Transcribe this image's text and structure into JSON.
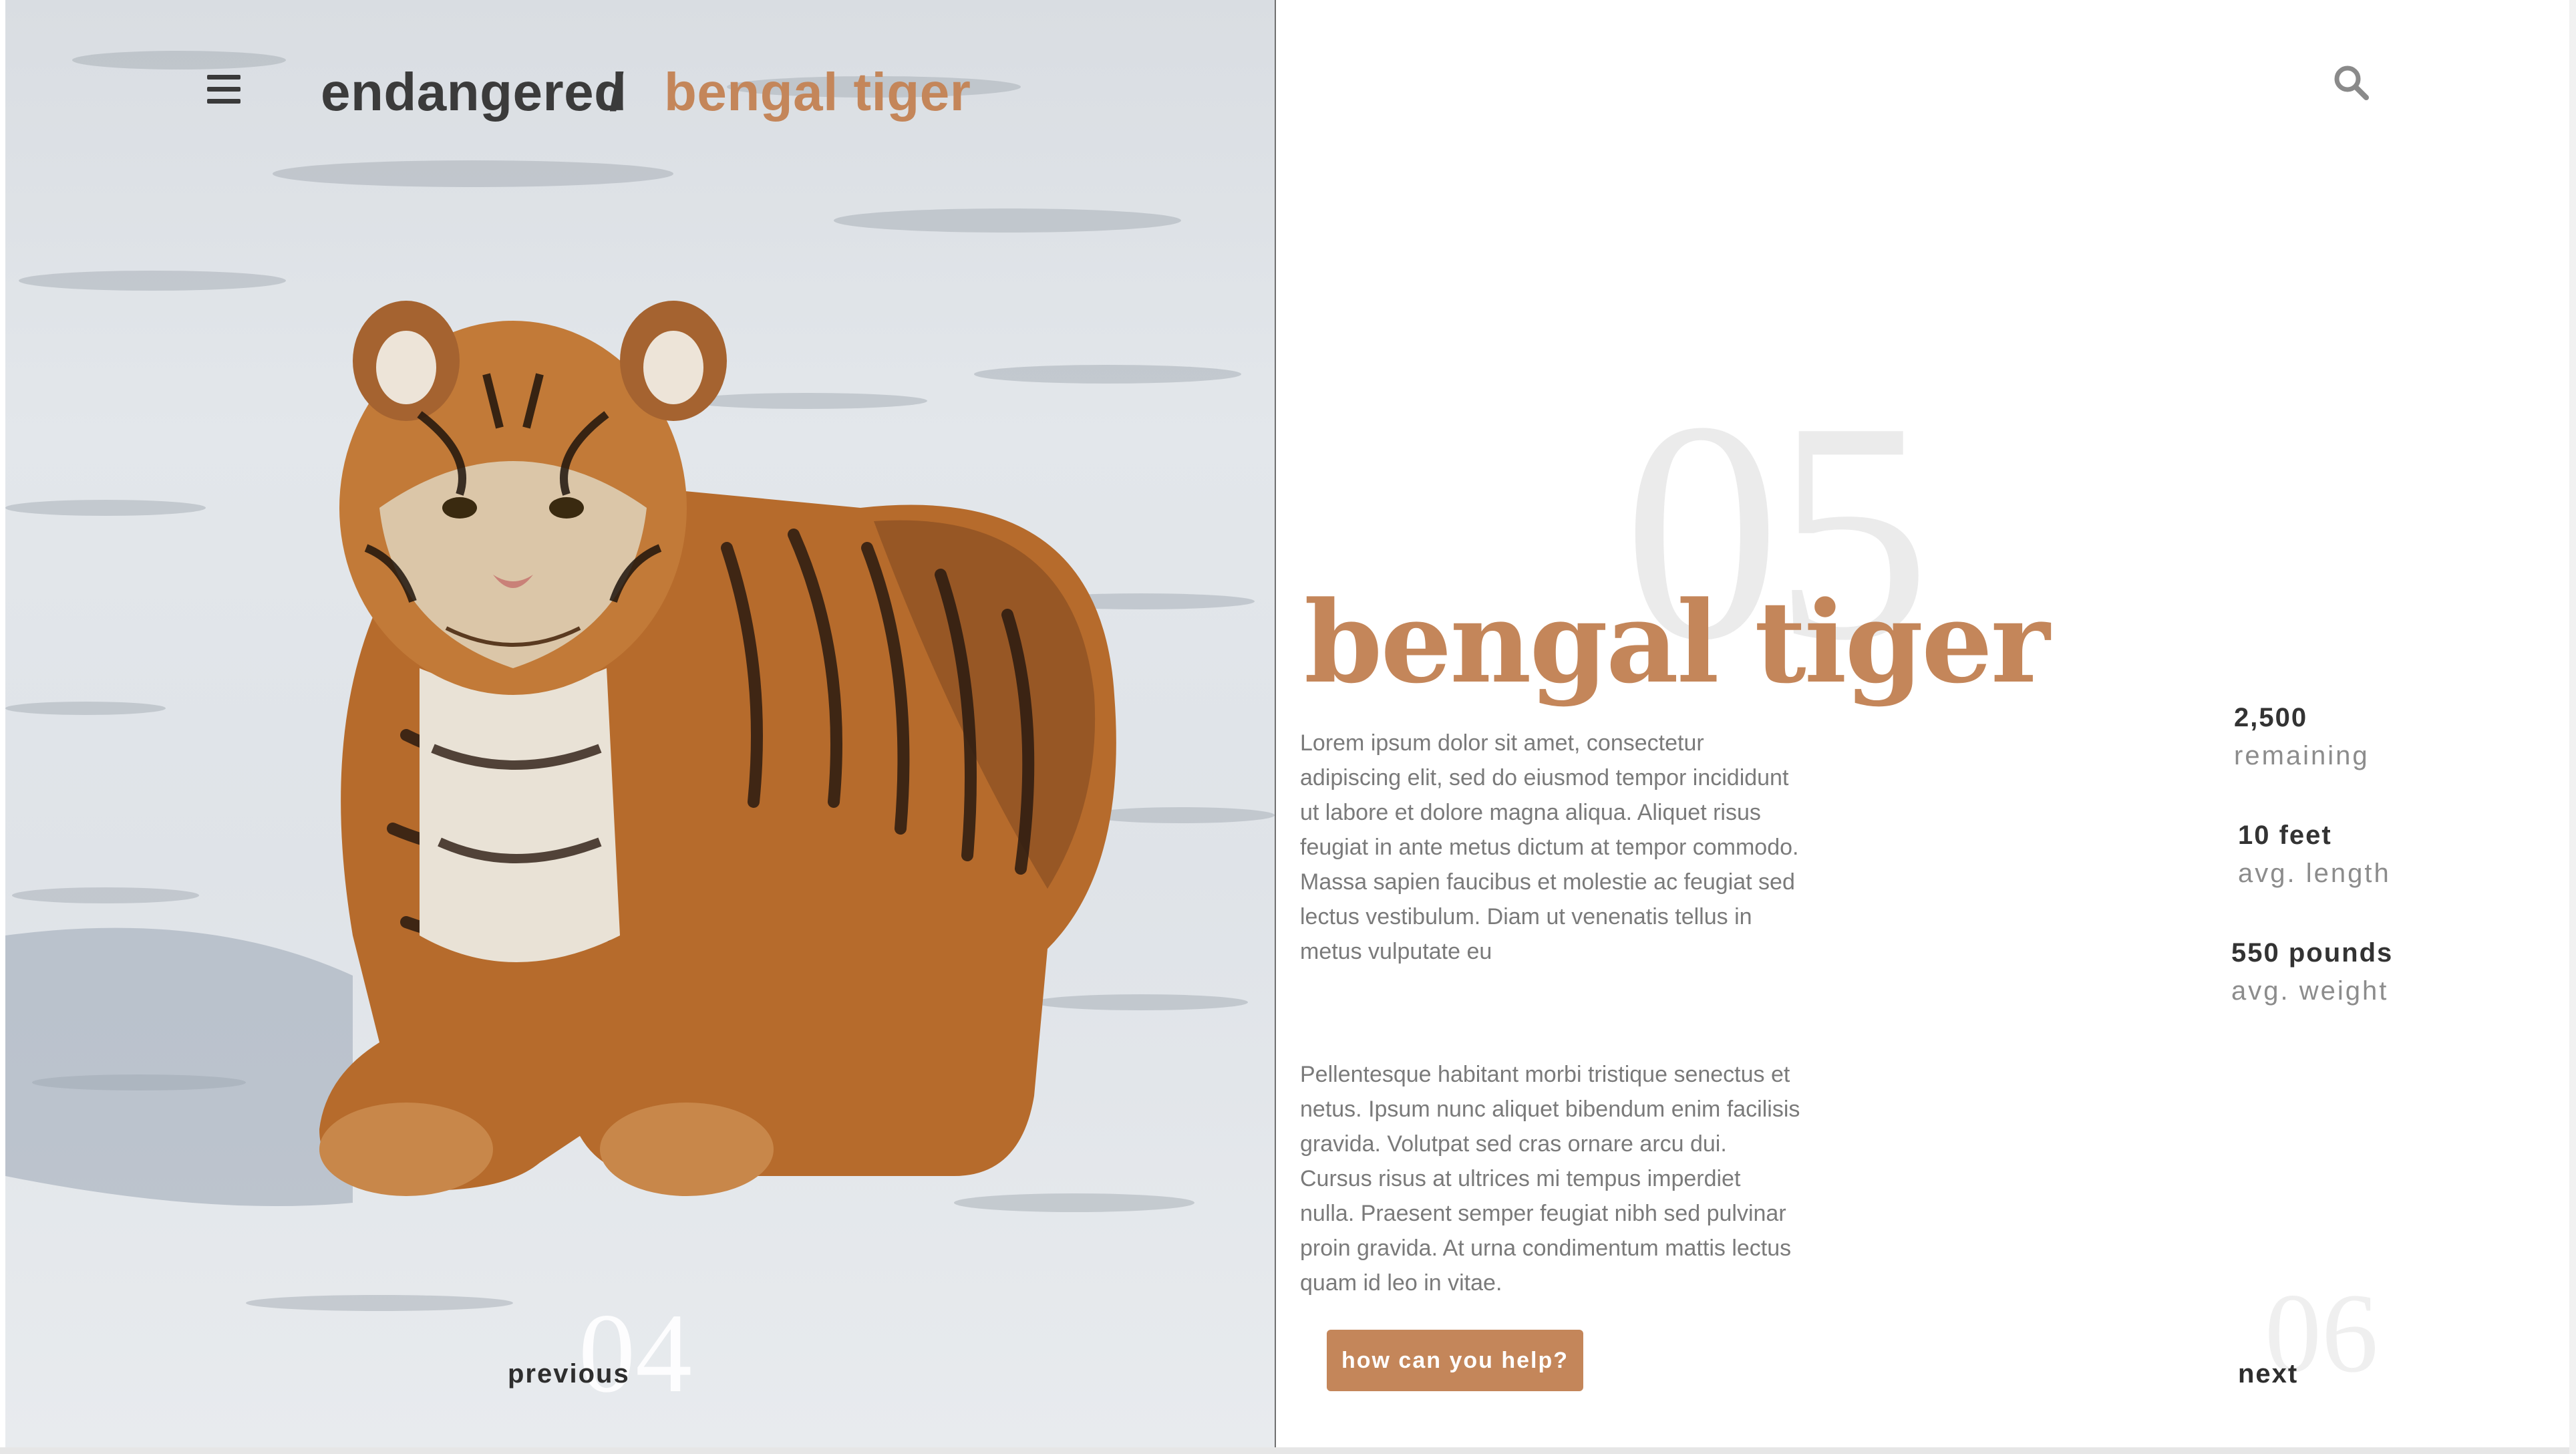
{
  "header": {
    "breadcrumb_root": "endangered",
    "breadcrumb_separator": "/",
    "breadcrumb_current": "bengal tiger",
    "menu_icon": "hamburger-menu-icon",
    "search_icon": "search-icon"
  },
  "photo": {
    "subject": "tiger-photo"
  },
  "main": {
    "index_number": "05",
    "title": "bengal tiger",
    "paragraph_1": "Lorem ipsum dolor sit amet, consectetur adipiscing elit, sed do eiusmod tempor incididunt ut labore et dolore magna aliqua. Aliquet risus feugiat in ante metus dictum at tempor commodo. Massa sapien faucibus et molestie ac feugiat sed lectus vestibulum. Diam ut venenatis tellus in metus vulputate eu",
    "paragraph_2": "Pellentesque habitant morbi tristique senectus et netus. Ipsum nunc aliquet bibendum enim facilisis gravida. Volutpat sed cras ornare arcu dui. Cursus risus at ultrices mi tempus imperdiet nulla. Praesent semper feugiat nibh sed pulvinar proin gravida. At urna condimentum mattis lectus quam id leo in vitae.",
    "cta_label": "how can you help?"
  },
  "stats": [
    {
      "value": "2,500",
      "label": "remaining"
    },
    {
      "value": "10 feet",
      "label": "avg. length"
    },
    {
      "value": "550 pounds",
      "label": "avg. weight"
    }
  ],
  "navigation": {
    "previous_label": "previous",
    "previous_number": "04",
    "next_label": "next",
    "next_number": "06"
  },
  "colors": {
    "accent": "#c4865a",
    "text_dark": "#333333",
    "text_muted": "#7a7a7a",
    "ghost_number": "#ebebeb"
  }
}
